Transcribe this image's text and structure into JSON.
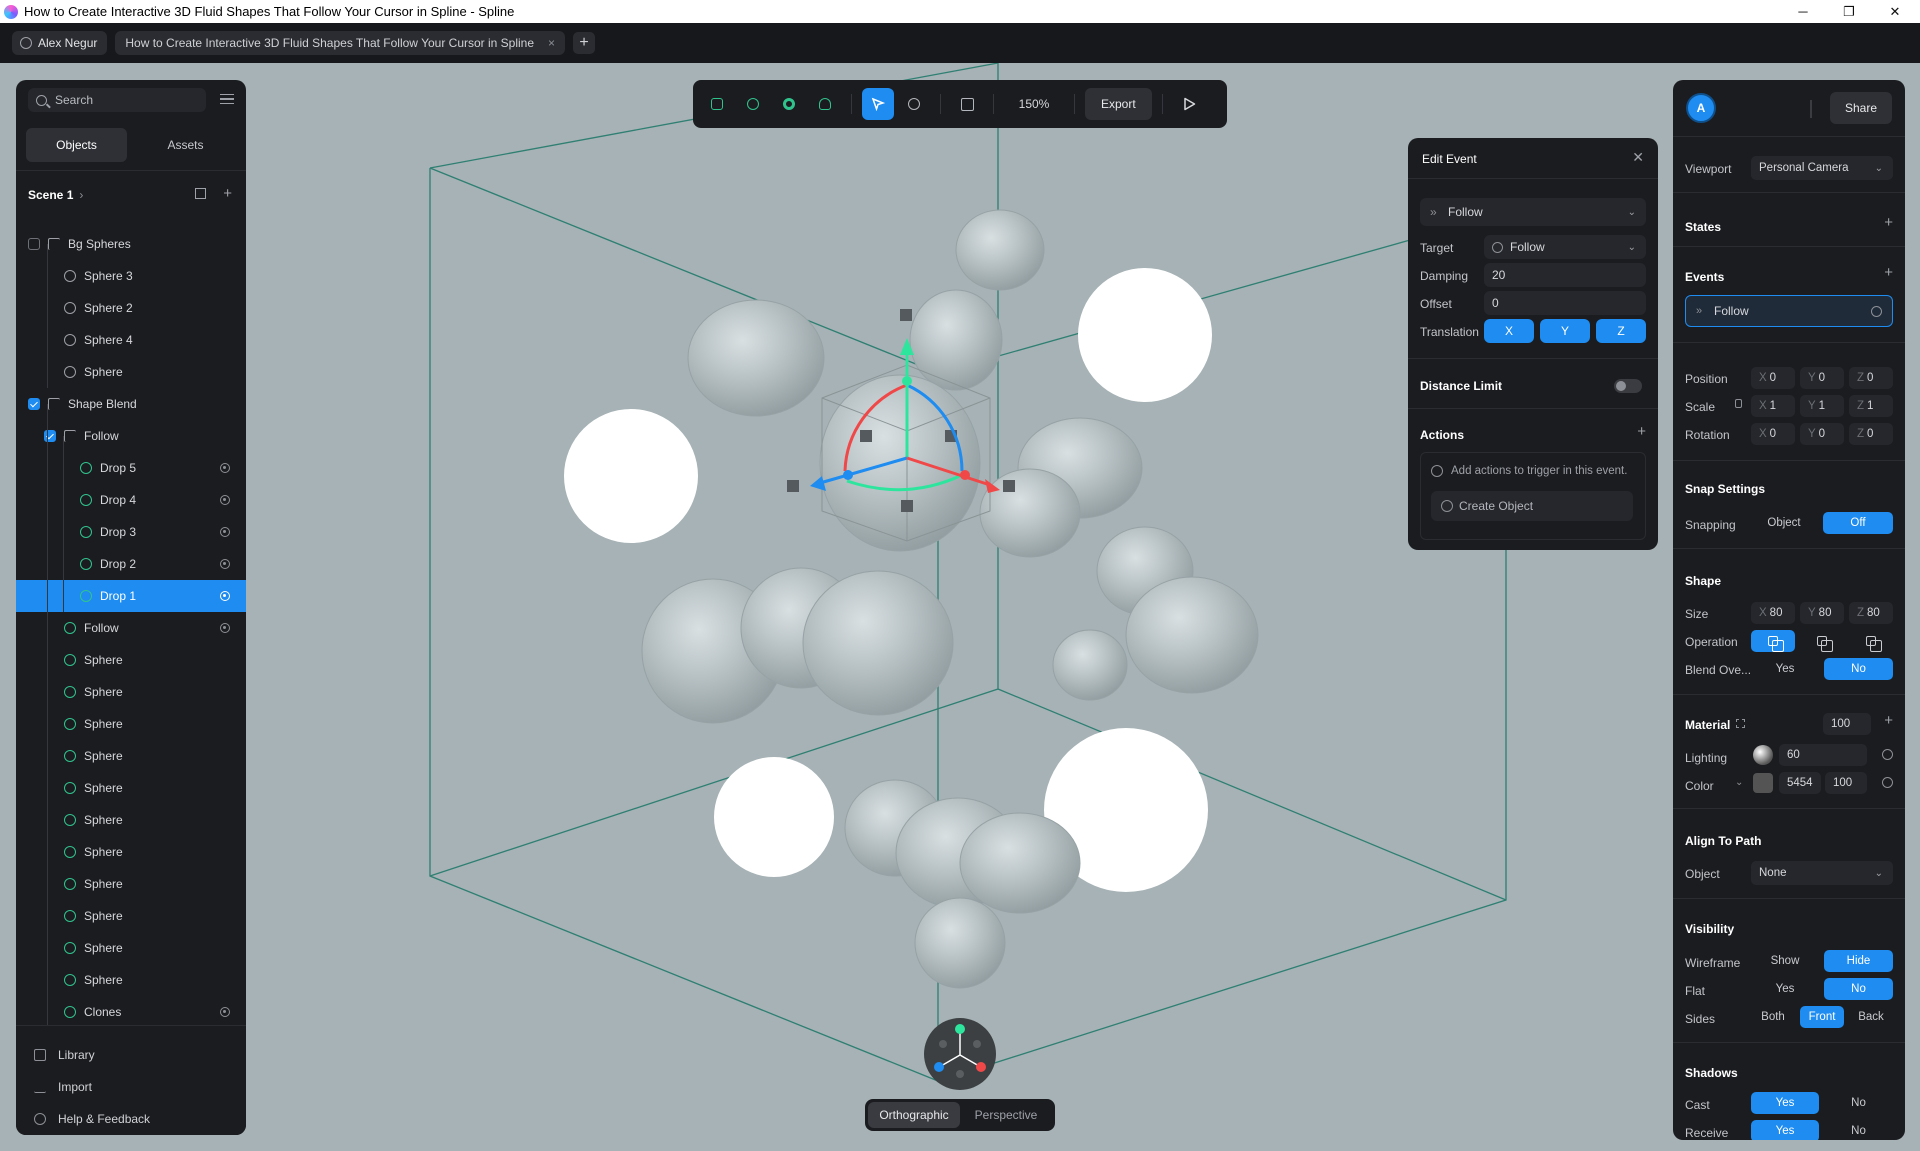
{
  "window": {
    "title": "How to Create Interactive 3D Fluid Shapes That Follow Your Cursor in Spline - Spline",
    "controls": [
      "─",
      "❐",
      "✕"
    ]
  },
  "appbar": {
    "user": "Alex Negur",
    "file_tab": "How to Create Interactive 3D Fluid Shapes That Follow Your Cursor in Spline",
    "close": "×",
    "add": "+"
  },
  "left": {
    "search_placeholder": "Search",
    "tabs": [
      "Objects",
      "Assets"
    ],
    "scene": "Scene 1",
    "scene_chevron": "›",
    "scene_add": "+",
    "tree": [
      {
        "label": "Bg Spheres",
        "icon": "group",
        "depth": 1,
        "check": "off"
      },
      {
        "label": "Sphere 3",
        "icon": "sphere",
        "depth": 2
      },
      {
        "label": "Sphere 2",
        "icon": "sphere",
        "depth": 2
      },
      {
        "label": "Sphere 4",
        "icon": "sphere",
        "depth": 2
      },
      {
        "label": "Sphere",
        "icon": "sphere",
        "depth": 2
      },
      {
        "label": "Shape Blend",
        "icon": "blend",
        "depth": 1,
        "check": "on"
      },
      {
        "label": "Follow",
        "icon": "group",
        "depth": 2,
        "check": "on"
      },
      {
        "label": "Drop 5",
        "icon": "green",
        "depth": 3,
        "eye": true
      },
      {
        "label": "Drop 4",
        "icon": "green",
        "depth": 3,
        "eye": true
      },
      {
        "label": "Drop 3",
        "icon": "green",
        "depth": 3,
        "eye": true
      },
      {
        "label": "Drop 2",
        "icon": "green",
        "depth": 3,
        "eye": true
      },
      {
        "label": "Drop 1",
        "icon": "green",
        "depth": 3,
        "eye": true,
        "selected": true
      },
      {
        "label": "Follow",
        "icon": "green",
        "depth": 2,
        "eye": true
      },
      {
        "label": "Sphere",
        "icon": "green",
        "depth": 2
      },
      {
        "label": "Sphere",
        "icon": "green",
        "depth": 2
      },
      {
        "label": "Sphere",
        "icon": "green",
        "depth": 2
      },
      {
        "label": "Sphere",
        "icon": "green",
        "depth": 2
      },
      {
        "label": "Sphere",
        "icon": "green",
        "depth": 2
      },
      {
        "label": "Sphere",
        "icon": "green",
        "depth": 2
      },
      {
        "label": "Sphere",
        "icon": "green",
        "depth": 2
      },
      {
        "label": "Sphere",
        "icon": "green",
        "depth": 2
      },
      {
        "label": "Sphere",
        "icon": "green",
        "depth": 2
      },
      {
        "label": "Sphere",
        "icon": "green",
        "depth": 2
      },
      {
        "label": "Sphere",
        "icon": "green",
        "depth": 2
      },
      {
        "label": "Clones",
        "icon": "green",
        "depth": 2,
        "eye": true
      }
    ],
    "bottom": [
      "Library",
      "Import",
      "Help & Feedback"
    ]
  },
  "toolbar": {
    "zoom": "150%",
    "export": "Export"
  },
  "edit_event": {
    "title": "Edit Event",
    "close": "✕",
    "event_type": "Follow",
    "target_label": "Target",
    "target_value": "Follow",
    "damping_label": "Damping",
    "damping_value": "20",
    "offset_label": "Offset",
    "offset_value": "0",
    "translation_label": "Translation",
    "axes": [
      "X",
      "Y",
      "Z"
    ],
    "distance_limit": "Distance Limit",
    "actions": "Actions",
    "actions_hint": "Add actions to trigger in this event.",
    "create_object": "Create Object",
    "chevrons": "»",
    "dropdown": "⌄",
    "plus": "+"
  },
  "right": {
    "avatar": "A",
    "share": "Share",
    "viewport_label": "Viewport",
    "viewport_value": "Personal Camera",
    "states": "States",
    "events": "Events",
    "event_item": "Follow",
    "position": {
      "label": "Position",
      "x": "0",
      "y": "0",
      "z": "0"
    },
    "scale": {
      "label": "Scale",
      "x": "1",
      "y": "1",
      "z": "1"
    },
    "rotation": {
      "label": "Rotation",
      "x": "0",
      "y": "0",
      "z": "0"
    },
    "axis_x": "X",
    "axis_y": "Y",
    "axis_z": "Z",
    "snap_settings": "Snap Settings",
    "snapping_label": "Snapping",
    "snapping_options": [
      "Object",
      "Off"
    ],
    "shape": "Shape",
    "size": {
      "label": "Size",
      "x": "80",
      "y": "80",
      "z": "80"
    },
    "operation_label": "Operation",
    "blend_label": "Blend Ove...",
    "blend_options": [
      "Yes",
      "No"
    ],
    "material": "Material",
    "material_value": "100",
    "lighting_label": "Lighting",
    "lighting_value": "60",
    "color_label": "Color",
    "color_hex": "5454",
    "color_opacity": "100",
    "align_to_path": "Align To Path",
    "object_label": "Object",
    "object_value": "None",
    "visibility": "Visibility",
    "wireframe_label": "Wireframe",
    "wireframe_options": [
      "Show",
      "Hide"
    ],
    "flat_label": "Flat",
    "flat_options": [
      "Yes",
      "No"
    ],
    "sides_label": "Sides",
    "sides_options": [
      "Both",
      "Front",
      "Back"
    ],
    "shadows": "Shadows",
    "cast_label": "Cast",
    "cast_options": [
      "Yes",
      "No"
    ],
    "receive_label": "Receive",
    "receive_options": [
      "Yes",
      "No"
    ],
    "plus": "+",
    "dropdown": "⌄"
  },
  "view_switch": [
    "Orthographic",
    "Perspective"
  ],
  "colors": {
    "accent": "#1e8cf0",
    "panel": "#1b1c20",
    "canvas": "#a6b2b5",
    "green": "#30c48d",
    "gizmo_red": "#f04848",
    "gizmo_green": "#2ee59d",
    "gizmo_blue": "#1e8cf0"
  }
}
